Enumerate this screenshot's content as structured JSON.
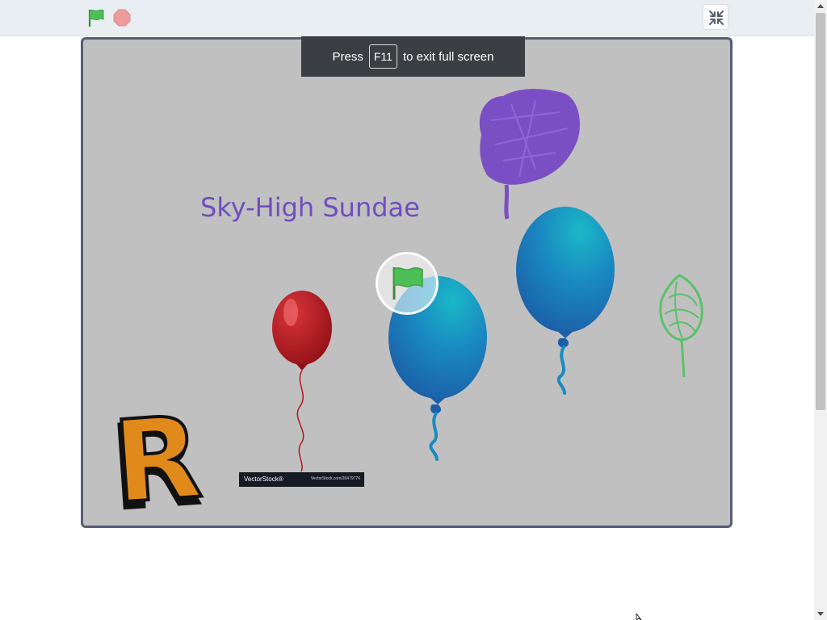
{
  "toolbar": {
    "green_flag_icon": "green-flag-icon",
    "stop_icon": "stop-sign-icon",
    "unfullscreen_icon": "collapse-fullscreen-icon"
  },
  "f11_notice": {
    "before": "Press",
    "key": "F11",
    "after": "to exit full screen"
  },
  "stage": {
    "title": "Sky-High Sundae",
    "watermark_brand": "VectorStock®",
    "watermark_fineprint": "VectorStock.com/26479776",
    "letter": "R"
  },
  "colors": {
    "stage_bg": "#c0c0c0",
    "title": "#6f4dc0",
    "flag_green": "#4cbf56",
    "stop_red": "#ec9c9c",
    "purple_cloud": "#7b4fc4",
    "green_tree": "#5cc06a",
    "red_balloon": "#b3161c",
    "blue_balloon": "#1d7fbf",
    "letter_orange": "#e08a1c"
  }
}
